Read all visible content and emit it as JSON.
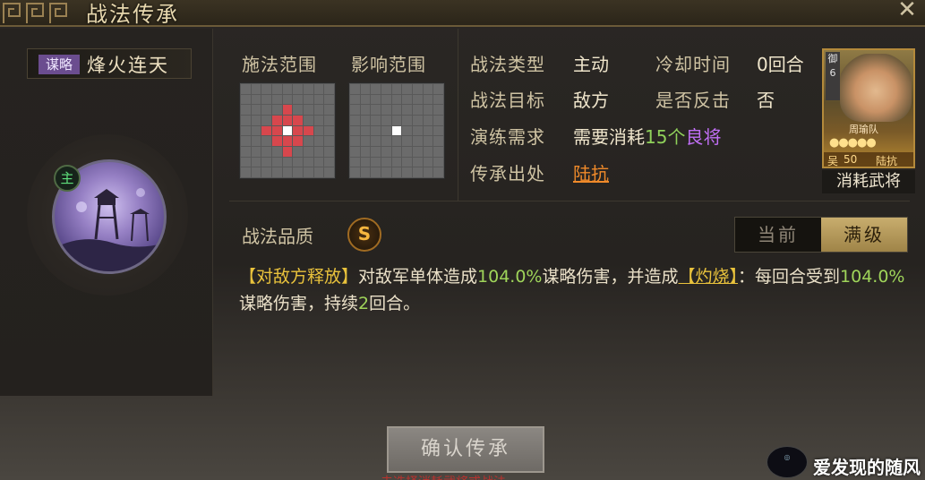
{
  "title": "战法传承",
  "skill": {
    "type_tag": "谋略",
    "name": "烽火连天",
    "main_badge": "主"
  },
  "range": {
    "cast_label": "施法范围",
    "effect_label": "影响范围"
  },
  "info": {
    "skill_type_label": "战法类型",
    "skill_type_value": "主动",
    "cooldown_label": "冷却时间",
    "cooldown_value": "0回合",
    "target_label": "战法目标",
    "target_value": "敌方",
    "counter_label": "是否反击",
    "counter_value": "否",
    "drill_label": "演练需求",
    "drill_prefix": "需要消耗",
    "drill_count": "15个",
    "drill_quality": "良将",
    "origin_label": "传承出处",
    "origin_value": "陆抗"
  },
  "hero_card": {
    "side_text": "御6",
    "unit_name": "周瑜队",
    "stars": "●●●●●",
    "faction": "吴",
    "level": "50",
    "name": "陆抗",
    "consume_label": "消耗武将"
  },
  "quality": {
    "label": "战法品质",
    "grade": "S"
  },
  "toggle": {
    "current": "当前",
    "max": "满级"
  },
  "description": {
    "tag": "【对敌方释放】",
    "part1": "对敌军单体造成",
    "pct1": "104.0%",
    "part2": "谋略伤害，并造成",
    "burn": "【灼烧】",
    "part3": "：每回合受到",
    "pct2": "104.0%",
    "part4": "谋略伤害，持续",
    "turns": "2",
    "part5": "回合。"
  },
  "confirm_button": "确认传承",
  "hint": "未选择消耗武将或战法",
  "watermark": {
    "text": "爱发现的随风"
  },
  "colors": {
    "red_cell": "#d7474d",
    "accent_gold": "#e9c23c",
    "purple_quality": "#c06ef5",
    "origin_orange": "#f08a2a"
  }
}
